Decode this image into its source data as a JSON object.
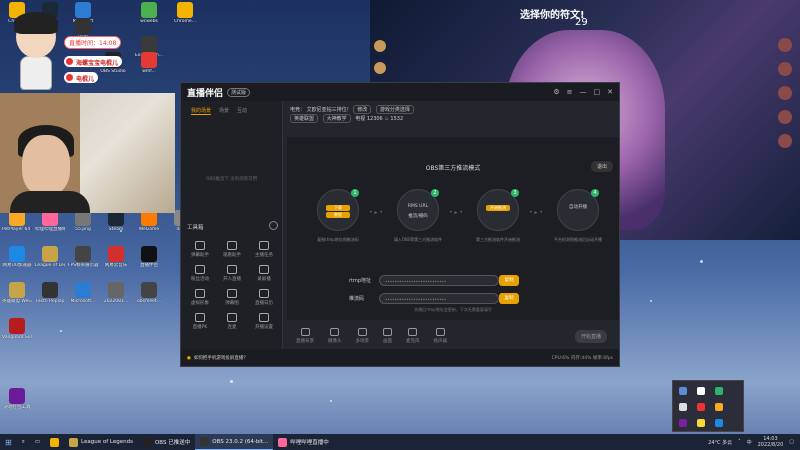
{
  "desktop": {
    "icons": [
      {
        "label": "Chrome",
        "color": "#f4b400"
      },
      {
        "label": "Steam",
        "color": "#1b2838"
      },
      {
        "label": "Microsoft",
        "color": "#2b7cd3"
      },
      {
        "label": "HUB",
        "color": "#333"
      },
      {
        "label": "wcwebs",
        "color": "#4caf50"
      },
      {
        "label": "Chrome...",
        "color": "#f4b400"
      },
      {
        "label": "ExitLag Sh...",
        "color": "#3a3a3a"
      },
      {
        "label": "OBS Studio",
        "color": "#222"
      },
      {
        "label": "wmf...",
        "color": "#e53935"
      },
      {
        "label": "PotPlayer 64 bit",
        "color": "#f9a825"
      },
      {
        "label": "哔哩哔哩直播姬",
        "color": "#ff6699"
      },
      {
        "label": "55.png",
        "color": "#777"
      },
      {
        "label": "Steam",
        "color": "#1b2838"
      },
      {
        "label": "WeGame",
        "color": "#ff7a00"
      },
      {
        "label": "44.jp",
        "color": "#888"
      },
      {
        "label": "网易UU加速器",
        "color": "#1e88e5"
      },
      {
        "label": "League of Legends",
        "color": "#c8a448"
      },
      {
        "label": "FPS帧率展示器",
        "color": "#444"
      },
      {
        "label": "网易云音乐",
        "color": "#d32f2f"
      },
      {
        "label": "直播伴侣",
        "color": "#111"
      },
      {
        "label": "英雄联盟 WeGame版",
        "color": "#c8a448"
      },
      {
        "label": "Fastn Replay",
        "color": "#333"
      },
      {
        "label": "Microsoft...",
        "color": "#2b7cd3"
      },
      {
        "label": "2022081...",
        "color": "#666"
      },
      {
        "label": "obsmeet...",
        "color": "#444"
      },
      {
        "label": "Vanguard Survivors",
        "color": "#b71c1c"
      },
      {
        "label": "游戏打包工具",
        "color": "#6a1b9a"
      }
    ]
  },
  "overlay": {
    "live_time": "直播时间：14:08",
    "brand_lines": [
      "海螺宝宝电棍儿",
      "电棍儿"
    ]
  },
  "game": {
    "title": "选择你的符文!",
    "timer": "29"
  },
  "obs": {
    "logo": "直播伴侣",
    "version": "测试版",
    "tabs": [
      "我的场景",
      "场景",
      "互动"
    ],
    "empty_scene_text": "OBS推流下 没有场景可用",
    "tools_heading": "工具箱",
    "tools": [
      "弹幕助手",
      "观看助手",
      "主播任务",
      "粉丝活动",
      "开人直播",
      "录屏播",
      "虚拟形象",
      "弹幕图",
      "直播日历",
      "直播PK",
      "连麦",
      "开播设置"
    ],
    "info": {
      "label": "电竞：",
      "stream_title": "艾欧尼亚钻三排位！",
      "tag1": "修改",
      "tag2": "游戏分类选择",
      "tag3": "英雄联盟",
      "tag4": "大神教学",
      "views_label": "电视",
      "views": "12306",
      "likes": "1532"
    },
    "mode_title": "OBS第三方推流模式",
    "exit_label": "退出",
    "steps": [
      {
        "n": "1",
        "title": "",
        "btn1": "下载",
        "btn2": "教程",
        "caption": "复制rtmp地址和推流码"
      },
      {
        "n": "2",
        "title": "RMS URL",
        "sub": "推流/播码",
        "caption": "填入OBS等第三方推流软件"
      },
      {
        "n": "3",
        "title": "",
        "btn1": "开始推流",
        "caption": "第三方推流软件开始推流"
      },
      {
        "n": "4",
        "title": "自动开播",
        "caption": "平台检测到推流后自动开播"
      }
    ],
    "rtmp_label": "rtmp地址",
    "rtmp_value": "••••••••••••••••••••••••••",
    "key_label": "推流码",
    "key_value": "••••••••••••••••••••••••••",
    "copy_label": "复制",
    "note": "关播后rtmp地址会更新，下次无需重复填写",
    "bottom_tools": [
      "直播背景",
      "摄像头",
      "多场景",
      "画面",
      "麦克风",
      "扬声器"
    ],
    "start_label": "开始直播",
    "status_tip": "如何把手机游戏投屏直播？",
    "status_right": "CPU:6% 内存:44% 帧率:0fps"
  },
  "taskbar": {
    "items": [
      {
        "label": "League of Legends",
        "color": "#c8a448",
        "active": false
      },
      {
        "label": "OBS 已推送中",
        "color": "#222",
        "active": false
      },
      {
        "label": "OBS 23.0.2 (64-bit...",
        "color": "#333",
        "active": true
      },
      {
        "label": "哔哩哔哩直播中",
        "color": "#ff6699",
        "active": false
      }
    ],
    "weather": "24°C 多云",
    "time": "14:03",
    "date": "2022/8/20",
    "ime": "中"
  }
}
